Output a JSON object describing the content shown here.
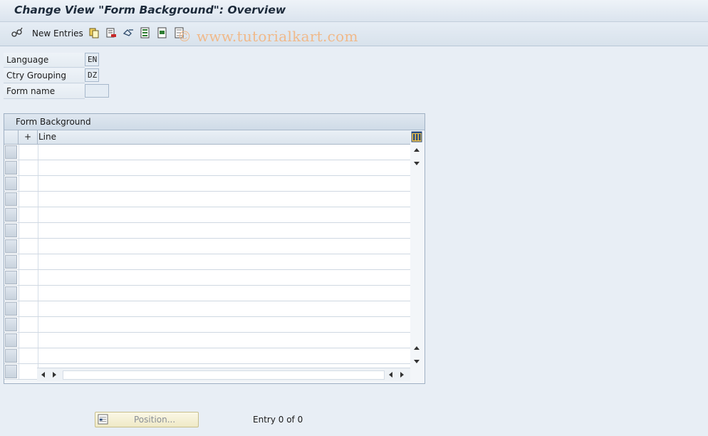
{
  "window": {
    "title": "Change View \"Form Background\": Overview"
  },
  "toolbar": {
    "new_entries_label": "New Entries",
    "icons": [
      "edit-glasses-icon",
      "copy-icon",
      "delete-icon",
      "undo-icon",
      "select-all-icon",
      "select-block-icon",
      "deselect-all-icon"
    ]
  },
  "watermark": "© www.tutorialkart.com",
  "fields": {
    "language": {
      "label": "Language",
      "value": "EN"
    },
    "ctry_grouping": {
      "label": "Ctry Grouping",
      "value": "DZ"
    },
    "form_name": {
      "label": "Form name",
      "value": ""
    }
  },
  "table": {
    "title": "Form Background",
    "columns": [
      "+",
      "Line"
    ],
    "row_count": 15
  },
  "footer": {
    "position_button": "Position...",
    "entry_text": "Entry 0 of 0"
  },
  "colors": {
    "background": "#e8eef5",
    "accent_yellow": "#efe9c6",
    "watermark": "#f0b98a"
  }
}
